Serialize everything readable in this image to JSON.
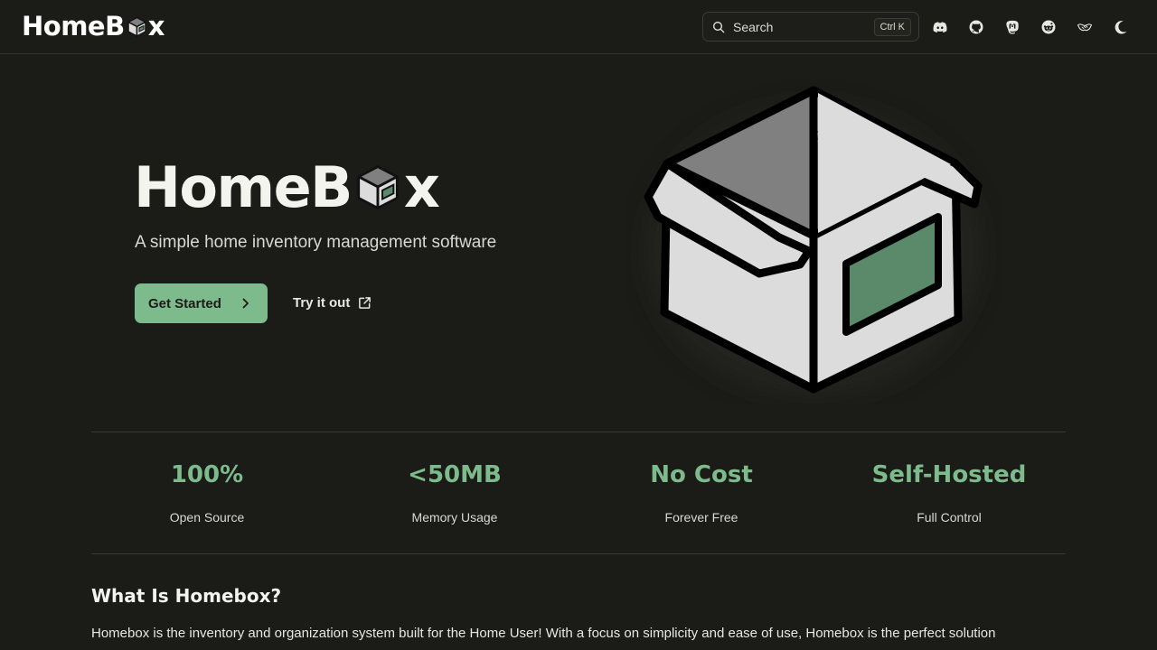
{
  "nav": {
    "brand_prefix": "HomeB",
    "brand_suffix": "x",
    "search": {
      "label": "Search",
      "shortcut": "Ctrl K"
    },
    "icons": [
      "discord-icon",
      "github-icon",
      "mastodon-icon",
      "reddit-icon",
      "sponsor-icon",
      "theme-toggle-icon"
    ]
  },
  "hero": {
    "logo_prefix": "HomeB",
    "logo_suffix": "x",
    "tagline": "A simple home inventory management software",
    "primary_button": "Get Started",
    "secondary_button": "Try it out"
  },
  "stats": [
    {
      "value": "100%",
      "label": "Open Source"
    },
    {
      "value": "<50MB",
      "label": "Memory Usage"
    },
    {
      "value": "No Cost",
      "label": "Forever Free"
    },
    {
      "value": "Self-Hosted",
      "label": "Full Control"
    }
  ],
  "about": {
    "title": "What Is Homebox?",
    "text": "Homebox is the inventory and organization system built for the Home User! With a focus on simplicity and ease of use, Homebox is the perfect solution"
  },
  "colors": {
    "background": "#1b1b17",
    "accent": "#7dba8c",
    "box_face": "#dcdcdc",
    "box_inner": "#808080",
    "box_label": "#5a8a6a"
  }
}
